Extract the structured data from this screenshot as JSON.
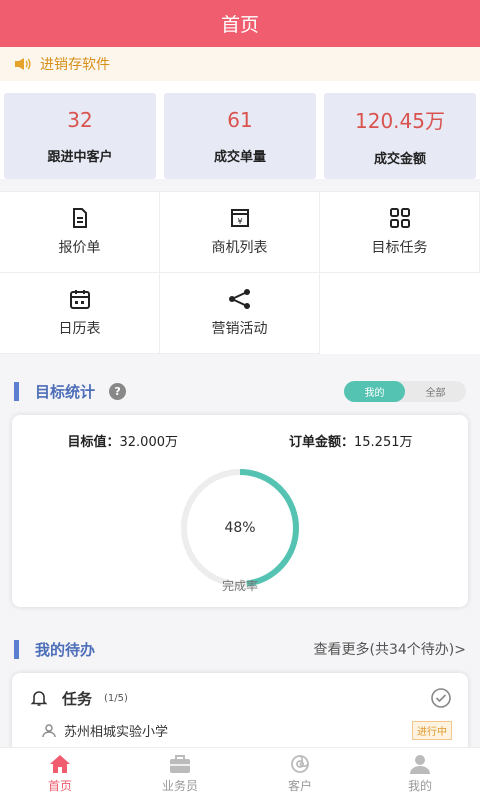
{
  "header": {
    "title": "首页"
  },
  "notice": {
    "text": "进销存软件"
  },
  "stats": [
    {
      "value": "32",
      "label": "跟进中客户"
    },
    {
      "value": "61",
      "label": "成交单量"
    },
    {
      "value": "120.45万",
      "label": "成交金额"
    }
  ],
  "menu": {
    "quote": "报价单",
    "opportunities": "商机列表",
    "targets": "目标任务",
    "calendar": "日历表",
    "marketing": "营销活动"
  },
  "target_stats": {
    "title": "目标统计",
    "help": "?",
    "toggle_mine": "我的",
    "toggle_all": "全部",
    "target_label": "目标值：",
    "target_value": "32.000万",
    "order_label": "订单金额：",
    "order_value": "15.251万",
    "progress_text": "48%",
    "progress": 0.48,
    "completion_label": "完成率"
  },
  "todo": {
    "title": "我的待办",
    "more": "查看更多(共34个待办)>",
    "task_label": "任务",
    "task_count": "(1/5)",
    "item_text": "苏州相城实验小学",
    "item_status": "进行中"
  },
  "tabbar": {
    "home": "首页",
    "salesman": "业务员",
    "customer": "客户",
    "mine": "我的"
  },
  "colors": {
    "brand": "#ef5d6e",
    "accent": "#55c3b2",
    "section": "#5a7fd1"
  }
}
